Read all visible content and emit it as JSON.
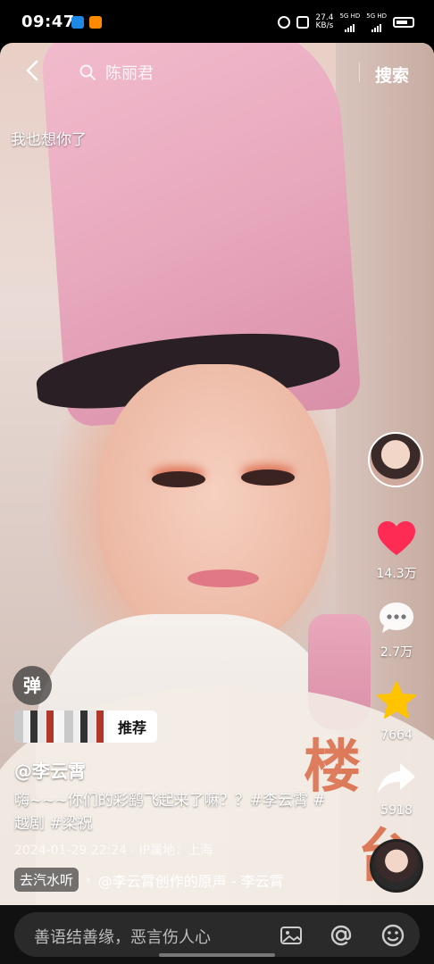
{
  "status_bar": {
    "time": "09:47",
    "speed_top": "27.4",
    "speed_bottom": "KB/s",
    "net1": "5G HD",
    "net2": "5G HD"
  },
  "search": {
    "query": "陈丽君",
    "button_label": "搜索"
  },
  "overlay_caption": "我也想你了",
  "rail": {
    "like_count": "14.3万",
    "comment_count": "2.7万",
    "favorite_count": "7664",
    "share_count": "5918"
  },
  "danmu_label": "弹",
  "recommend_label": "推荐",
  "author": "@李云霄",
  "description": "嗨~~~你们的彩鹞飞起来了嘛？？#李云霄 #越剧 #梁祝",
  "meta": "2024-01-29 22:24 · IP属地：上海",
  "music_chip": "去汽水听",
  "music_text": "@李云霄创作的原声 - 李云霄",
  "comment_placeholder": "善语结善缘，恶言伤人心",
  "colors": {
    "like": "#fe2c55",
    "favorite": "#ffc300",
    "fan_glyph": "#d8542a"
  },
  "fan_glyphs": [
    "楼",
    "台"
  ]
}
